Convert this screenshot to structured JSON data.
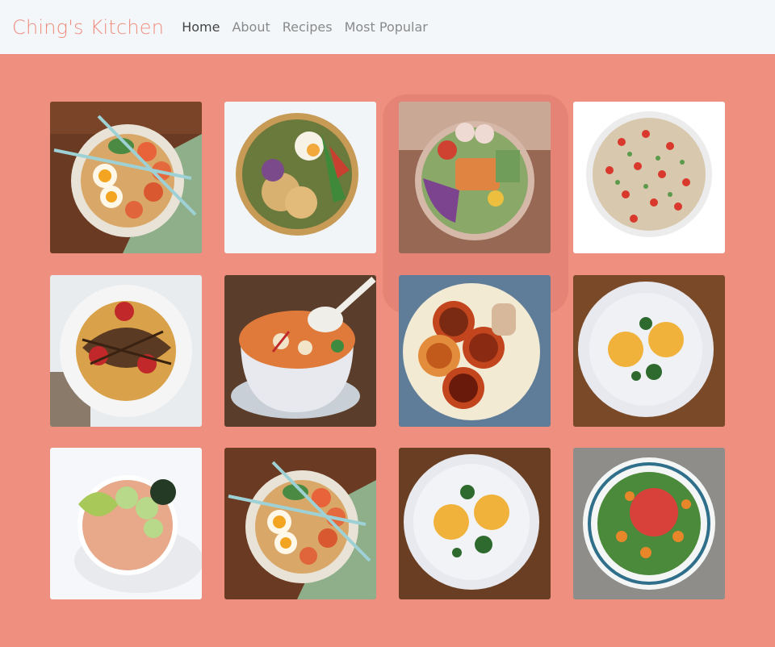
{
  "brand": "Ching's Kitchen",
  "nav": {
    "items": [
      {
        "label": "Home",
        "active": true
      },
      {
        "label": "About",
        "active": false
      },
      {
        "label": "Recipes",
        "active": false
      },
      {
        "label": "Most Popular",
        "active": false
      }
    ]
  },
  "colors": {
    "page_background": "#ee8f80",
    "navbar_background": "#f4f7fa",
    "brand": "#ef8d7e"
  },
  "gallery": {
    "items": [
      {
        "dish": "ramen-bowl-photo",
        "background": "wood"
      },
      {
        "dish": "crispy-chicken-bowl-photo",
        "background": "white"
      },
      {
        "dish": "salmon-poke-bowl-photo",
        "background": "wood"
      },
      {
        "dish": "tomato-quinoa-salad-photo",
        "background": "white"
      },
      {
        "dish": "chocolate-strawberry-waffle-photo",
        "background": "white"
      },
      {
        "dish": "tom-yum-soup-photo",
        "background": "wood"
      },
      {
        "dish": "grilled-peaches-photo",
        "background": "blue"
      },
      {
        "dish": "eggs-benedict-photo",
        "background": "wood"
      },
      {
        "dish": "poke-avocado-bowl-photo",
        "background": "white"
      },
      {
        "dish": "ramen-bowl-photo",
        "background": "wood"
      },
      {
        "dish": "eggs-benedict-photo",
        "background": "wood"
      },
      {
        "dish": "veggie-salad-bowl-photo",
        "background": "gray"
      }
    ]
  }
}
